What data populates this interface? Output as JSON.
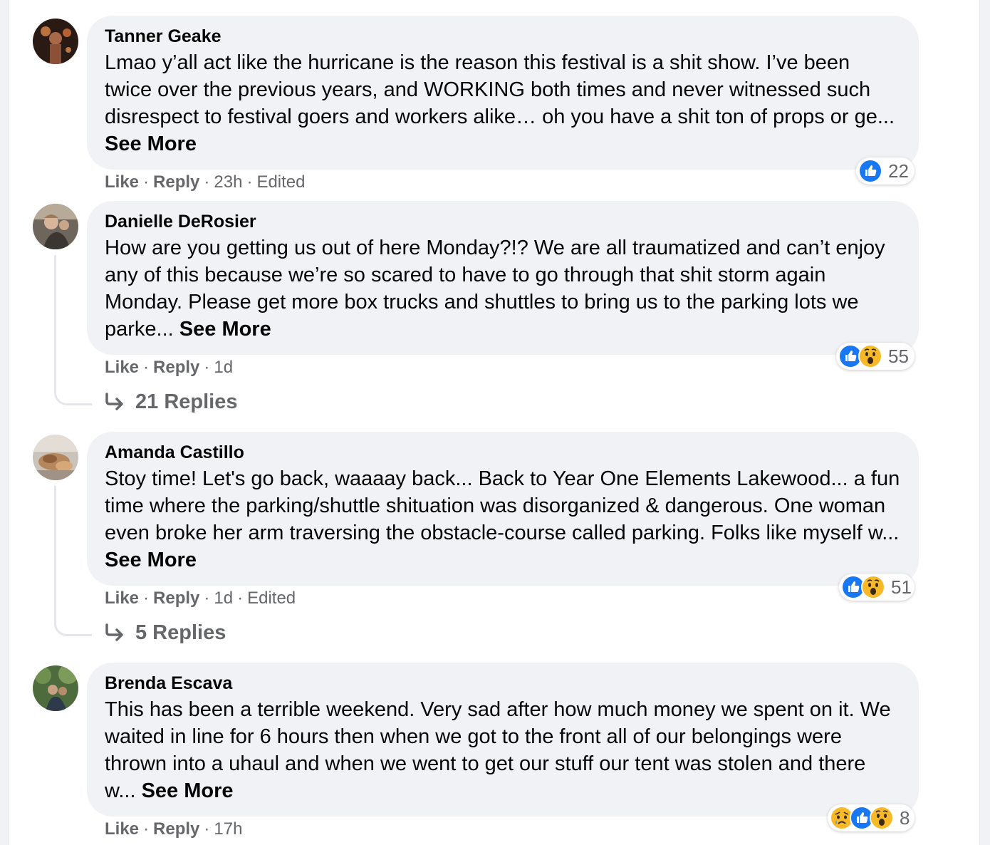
{
  "comments": [
    {
      "author": "Tanner Geake",
      "text": "Lmao y’all act like the hurricane is the reason this festival is a shit show. I’ve been twice over the previous years, and WORKING both times and never witnessed such disrespect to festival goers and workers alike… oh you have a shit ton of props or ge...",
      "see_more": "See More",
      "like": "Like",
      "reply": "Reply",
      "time": "23h",
      "edited": "Edited",
      "reaction_count": "22",
      "reaction_icons": [
        "like-icon"
      ]
    },
    {
      "author": "Danielle DeRosier",
      "text": "How are you getting us out of here Monday?!? We are all traumatized and can’t enjoy any of this because we’re so scared to have to go through that shit storm again Monday. Please get more box trucks and shuttles to bring us to the parking lots we parke...",
      "see_more": "See More",
      "like": "Like",
      "reply": "Reply",
      "time": "1d",
      "edited": "",
      "reaction_count": "55",
      "reaction_icons": [
        "like-icon",
        "wow-icon"
      ],
      "replies_label": "21 Replies"
    },
    {
      "author": "Amanda Castillo",
      "text": "Stoy time! Let's go back, waaaay back... Back to Year One Elements Lakewood... a fun time where the parking/shuttle shituation was disorganized & dangerous. One woman even broke her arm traversing the obstacle-course called parking. Folks like myself w...",
      "see_more": "See More",
      "like": "Like",
      "reply": "Reply",
      "time": "1d",
      "edited": "Edited",
      "reaction_count": "51",
      "reaction_icons": [
        "like-icon",
        "wow-icon"
      ],
      "replies_label": "5 Replies"
    },
    {
      "author": "Brenda Escava",
      "text": "This has been a terrible weekend. Very sad after how much money we spent on it. We waited in line for 6 hours then when we got to the front all of our belongings were thrown into a uhaul and when we went to get our stuff our tent was stolen and there w...",
      "see_more": "See More",
      "like": "Like",
      "reply": "Reply",
      "time": "17h",
      "edited": "",
      "reaction_count": "8",
      "reaction_icons": [
        "sad-icon",
        "like-icon",
        "wow-icon"
      ]
    }
  ],
  "separator": "·",
  "colors": {
    "bubble": "#f0f2f5",
    "meta_text": "#65676b",
    "like_blue": "#1877f2",
    "wow_yellow": "#f7b928"
  }
}
